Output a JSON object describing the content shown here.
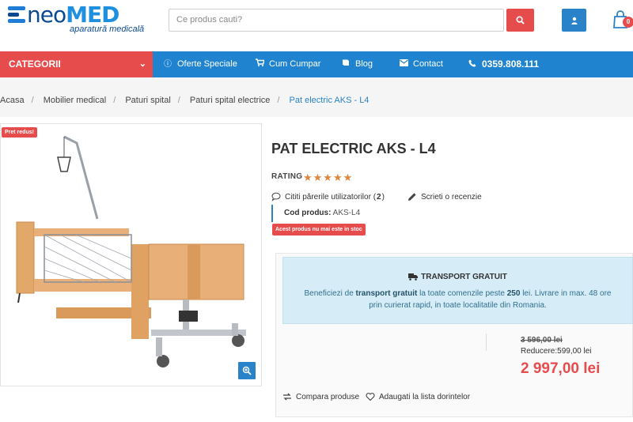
{
  "header": {
    "logo_neo": "neo",
    "logo_med": "MED",
    "logo_tagline": "aparatură medicală",
    "search_placeholder": "Ce produs cauti?",
    "cart_count": "0"
  },
  "nav": {
    "categories_label": "CATEGORII",
    "items": [
      {
        "label": "Oferte Speciale",
        "icon": "info-icon"
      },
      {
        "label": "Cum Cumpar",
        "icon": "cart-icon"
      },
      {
        "label": "Blog",
        "icon": "book-icon"
      },
      {
        "label": "Contact",
        "icon": "envelope-icon"
      },
      {
        "label": "0359.808.111",
        "icon": "phone-icon"
      }
    ]
  },
  "breadcrumb": [
    "Acasa",
    "Mobilier medical",
    "Paturi spital",
    "Paturi spital electrice",
    "Pat electric AKS - L4"
  ],
  "product": {
    "promo_badge": "Pret redus!",
    "title": "PAT ELECTRIC AKS - L4",
    "rating_label": "RATING",
    "rating": 5,
    "stars": "★★★★★",
    "reviews_text": "Cititi părerile utilizatorilor (",
    "reviews_count": "2",
    "reviews_close": ")",
    "write_review": "Scrieti o recenzie",
    "code_label": "Cod produs:",
    "code_value": "AKS-L4",
    "stock_status": "Acest produs nu mai este in stoc"
  },
  "shipping": {
    "title": "TRANSPORT GRATUIT",
    "text_1": "Beneficiezi de ",
    "text_bold_1": "transport gratuit",
    "text_2": " la toate comenzile peste ",
    "text_bold_2": "250",
    "text_3": " lei. Livrare in max. 48 ore prin curierat rapid, in toate localitatile din Romania."
  },
  "pricing": {
    "old_price": "3 596,00 lei",
    "discount": "Reducere:599,00 lei",
    "new_price": "2 997,00 lei"
  },
  "actions": {
    "compare": "Compara produse",
    "wishlist": "Adaugati la lista dorintelor"
  },
  "colors": {
    "brand_blue": "#1f83cf",
    "accent_red": "#e74c4c",
    "ship_bg": "#d6ecf6"
  }
}
